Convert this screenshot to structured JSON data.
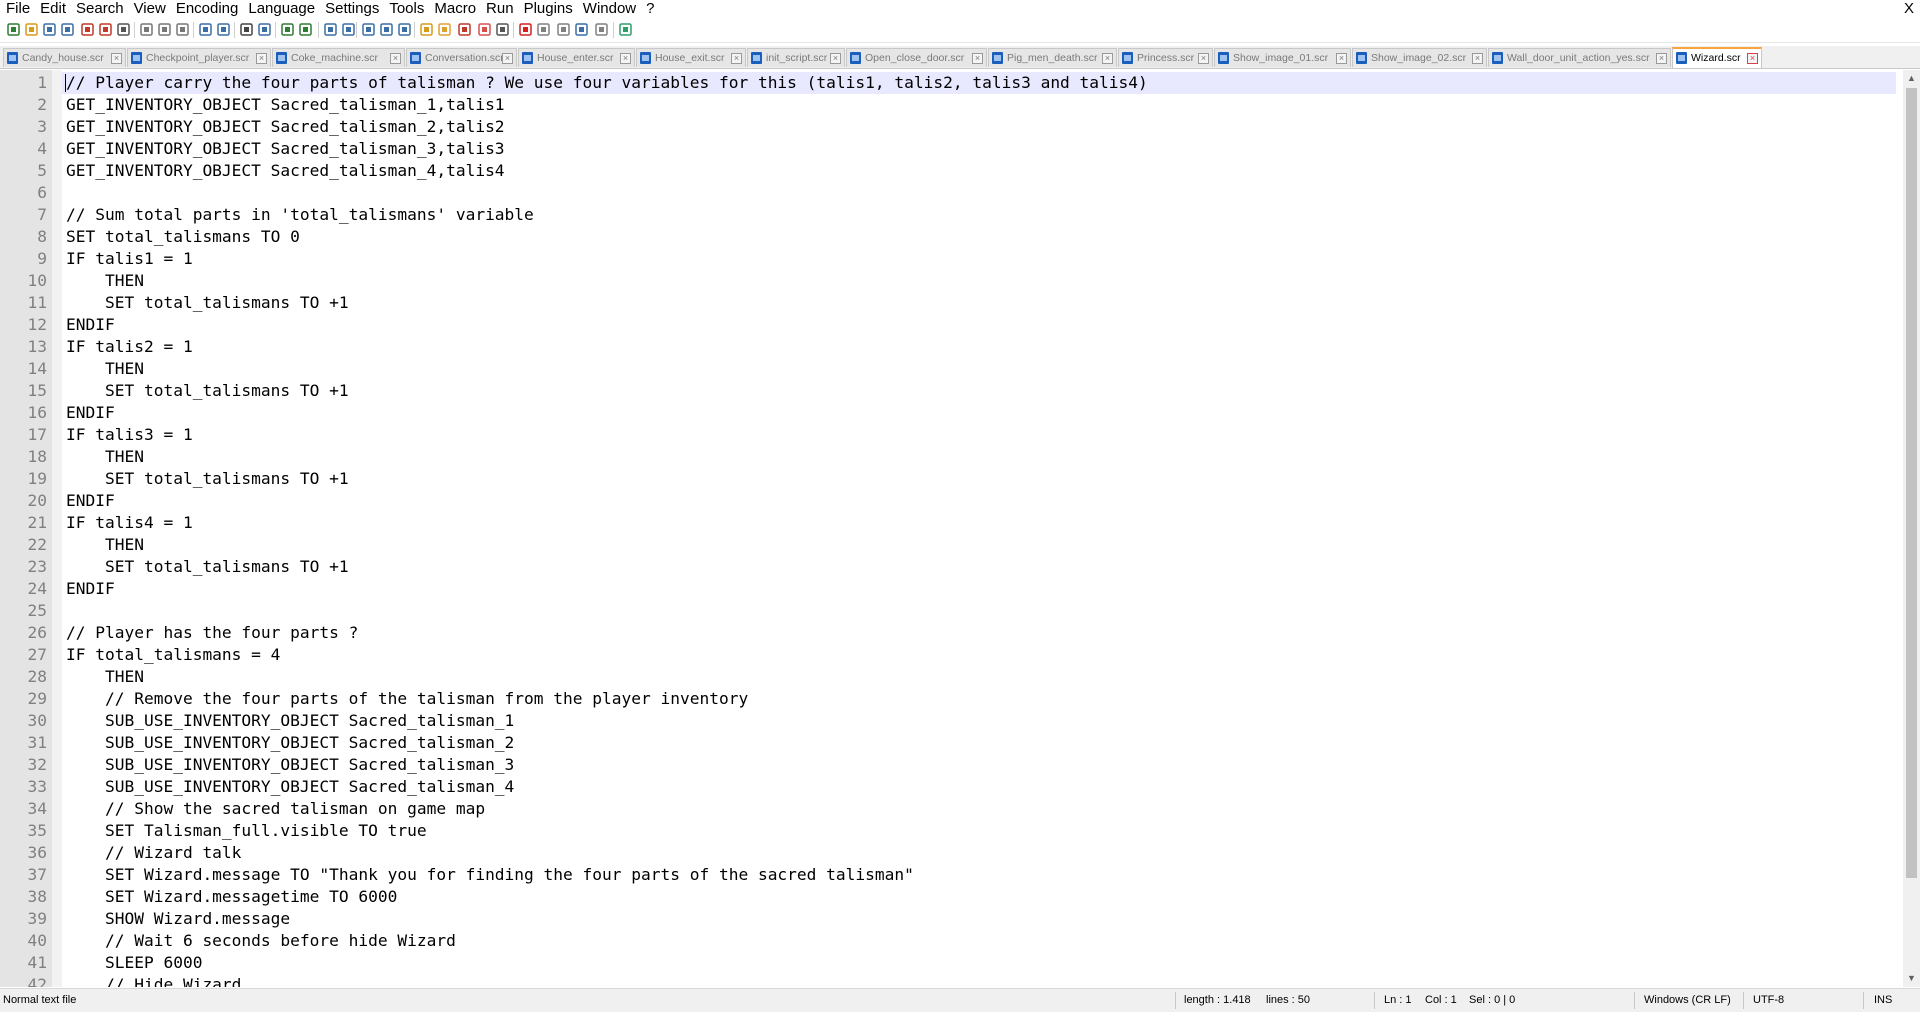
{
  "menu": [
    "File",
    "Edit",
    "Search",
    "View",
    "Encoding",
    "Language",
    "Settings",
    "Tools",
    "Macro",
    "Run",
    "Plugins",
    "Window",
    "?"
  ],
  "window_close": "X",
  "toolbar_icons": [
    "new-file-icon",
    "open-file-icon",
    "save-icon",
    "save-all-icon",
    "close-icon",
    "close-all-icon",
    "print-icon",
    "cut-icon",
    "copy-icon",
    "paste-icon",
    "undo-icon",
    "redo-icon",
    "find-icon",
    "replace-icon",
    "zoom-in-icon",
    "zoom-out-icon",
    "sync-vertical-icon",
    "sync-horizontal-icon",
    "word-wrap-icon",
    "show-all-characters-icon",
    "indent-guide-icon",
    "user-language-icon",
    "doc-map-icon",
    "function-list-icon",
    "folder-as-workspace-icon",
    "monitoring-icon",
    "record-macro-icon",
    "stop-recording-icon",
    "playback-macro-icon",
    "run-macro-multiple-icon",
    "save-macro-icon",
    "spell-check-icon"
  ],
  "tabs": [
    {
      "label": "Candy_house.scr",
      "active": false
    },
    {
      "label": "Checkpoint_player.scr",
      "active": false
    },
    {
      "label": "Coke_machine.scr",
      "active": false
    },
    {
      "label": "Conversation.scr",
      "active": false
    },
    {
      "label": "House_enter.scr",
      "active": false
    },
    {
      "label": "House_exit.scr",
      "active": false
    },
    {
      "label": "init_script.scr",
      "active": false
    },
    {
      "label": "Open_close_door.scr",
      "active": false
    },
    {
      "label": "Pig_men_death.scr",
      "active": false
    },
    {
      "label": "Princess.scr",
      "active": false
    },
    {
      "label": "Show_image_01.scr",
      "active": false
    },
    {
      "label": "Show_image_02.scr",
      "active": false
    },
    {
      "label": "Wall_door_unit_action_yes.scr",
      "active": false
    },
    {
      "label": "Wizard.scr",
      "active": true
    }
  ],
  "editor": {
    "current_line": 1,
    "lines": [
      "// Player carry the four parts of talisman ? We use four variables for this (talis1, talis2, talis3 and talis4)",
      "GET_INVENTORY_OBJECT Sacred_talisman_1,talis1",
      "GET_INVENTORY_OBJECT Sacred_talisman_2,talis2",
      "GET_INVENTORY_OBJECT Sacred_talisman_3,talis3",
      "GET_INVENTORY_OBJECT Sacred_talisman_4,talis4",
      "",
      "// Sum total parts in 'total_talismans' variable",
      "SET total_talismans TO 0",
      "IF talis1 = 1",
      "    THEN",
      "    SET total_talismans TO +1",
      "ENDIF",
      "IF talis2 = 1",
      "    THEN",
      "    SET total_talismans TO +1",
      "ENDIF",
      "IF talis3 = 1",
      "    THEN",
      "    SET total_talismans TO +1",
      "ENDIF",
      "IF talis4 = 1",
      "    THEN",
      "    SET total_talismans TO +1",
      "ENDIF",
      "",
      "// Player has the four parts ?",
      "IF total_talismans = 4",
      "    THEN",
      "    // Remove the four parts of the talisman from the player inventory",
      "    SUB_USE_INVENTORY_OBJECT Sacred_talisman_1",
      "    SUB_USE_INVENTORY_OBJECT Sacred_talisman_2",
      "    SUB_USE_INVENTORY_OBJECT Sacred_talisman_3",
      "    SUB_USE_INVENTORY_OBJECT Sacred_talisman_4",
      "    // Show the sacred talisman on game map",
      "    SET Talisman_full.visible TO true",
      "    // Wizard talk",
      "    SET Wizard.message TO \"Thank you for finding the four parts of the sacred talisman\"",
      "    SET Wizard.messagetime TO 6000",
      "    SHOW Wizard.message",
      "    // Wait 6 seconds before hide Wizard",
      "    SLEEP 6000",
      "    // Hide Wizard"
    ]
  },
  "status": {
    "file_type": "Normal text file",
    "length": "length : 1.418",
    "lines": "lines : 50",
    "ln": "Ln : 1",
    "col": "Col : 1",
    "sel": "Sel : 0 | 0",
    "eol": "Windows (CR LF)",
    "encoding": "UTF-8",
    "mode": "INS"
  },
  "colors": {
    "current_line_bg": "#e8e8ff",
    "gutter_bg": "#e4e4e4",
    "line_number": "#808080",
    "active_tab_accent": "#f6a53b",
    "tab_icon": "#1a5fbd"
  }
}
